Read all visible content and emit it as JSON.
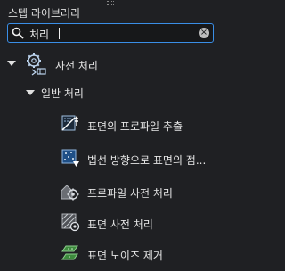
{
  "panel": {
    "title": "스텝 라이브러리"
  },
  "search": {
    "value": "처리"
  },
  "tree": {
    "category": {
      "label": "사전 처리",
      "icon": "gear-process-icon"
    },
    "subcategory": {
      "label": "일반 처리"
    },
    "items": [
      {
        "label": "표면의 프로파일 추출",
        "icon": "surface-profile-extract-icon"
      },
      {
        "label": "법선 방향으로 표면의 점...",
        "icon": "normal-direction-points-icon"
      },
      {
        "label": "프로파일 사전 처리",
        "icon": "profile-preprocess-icon"
      },
      {
        "label": "표면 사전 처리",
        "icon": "surface-preprocess-icon"
      },
      {
        "label": "표면 노이즈 제거",
        "icon": "surface-noise-removal-icon"
      }
    ]
  },
  "colors": {
    "accent": "#3a8ee6",
    "background": "#1f2023",
    "text": "#e4e4e4"
  }
}
